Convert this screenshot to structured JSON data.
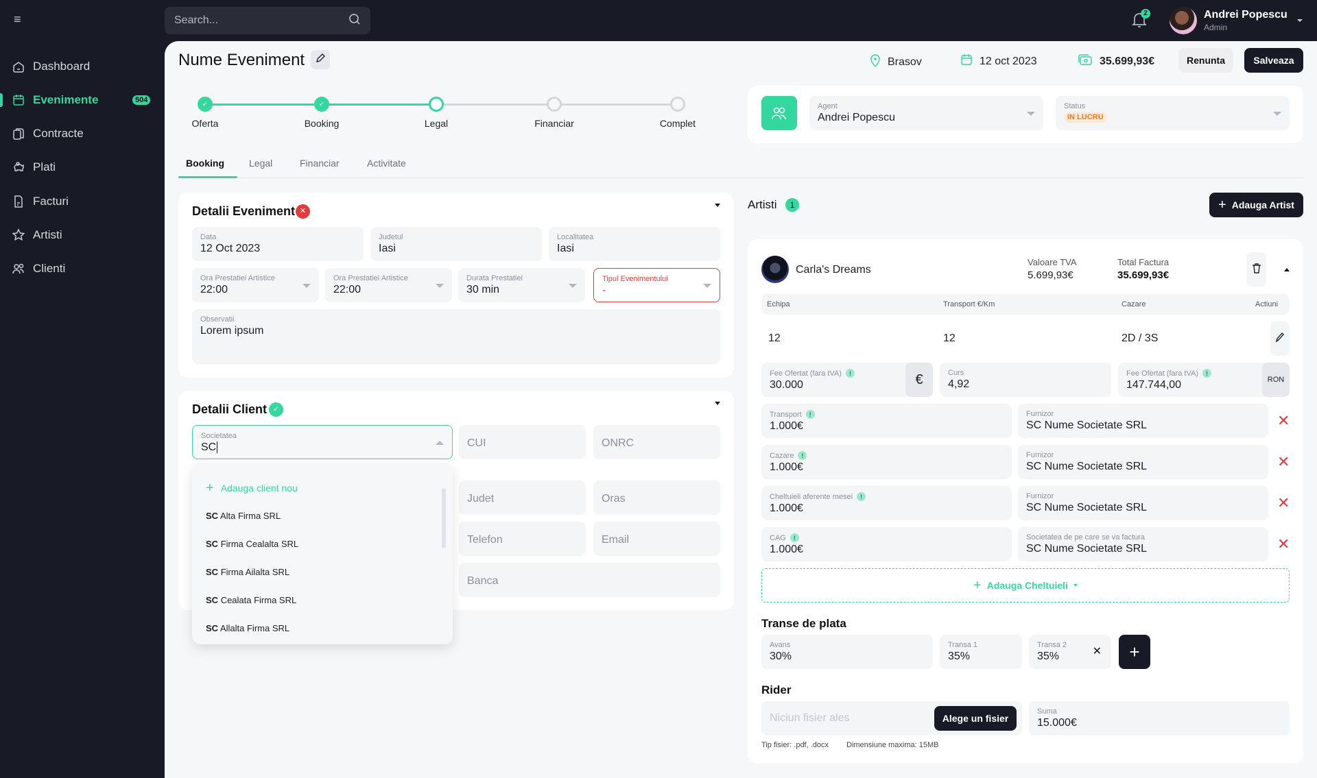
{
  "sidebar": {
    "menu_icon": "hamburger-icon",
    "items": [
      {
        "label": "Dashboard",
        "icon": "home-icon"
      },
      {
        "label": "Evenimente",
        "icon": "calendar-icon",
        "badge": "504",
        "active": true
      },
      {
        "label": "Contracte",
        "icon": "documents-icon"
      },
      {
        "label": "Plati",
        "icon": "piggy-bank-icon"
      },
      {
        "label": "Facturi",
        "icon": "invoice-icon"
      },
      {
        "label": "Artisti",
        "icon": "star-icon"
      },
      {
        "label": "Clienti",
        "icon": "users-icon"
      }
    ]
  },
  "topbar": {
    "search_placeholder": "Search...",
    "notifications_count": "2",
    "user": {
      "name": "Andrei Popescu",
      "role": "Admin"
    }
  },
  "header": {
    "title": "Nume Eveniment",
    "location": "Brasov",
    "date": "12 oct 2023",
    "total": "35.699,93€",
    "cancel_label": "Renunta",
    "save_label": "Salveaza"
  },
  "stepper": {
    "steps": [
      {
        "label": "Oferta",
        "state": "done"
      },
      {
        "label": "Booking",
        "state": "done"
      },
      {
        "label": "Legal",
        "state": "current"
      },
      {
        "label": "Financiar",
        "state": "todo"
      },
      {
        "label": "Complet",
        "state": "todo"
      }
    ]
  },
  "tabs": [
    {
      "label": "Booking",
      "active": true
    },
    {
      "label": "Legal"
    },
    {
      "label": "Financiar"
    },
    {
      "label": "Activitate"
    }
  ],
  "event_details": {
    "title": "Detalii Eveniment",
    "status": "error",
    "fields": {
      "data": {
        "label": "Data",
        "value": "12 Oct 2023"
      },
      "judet": {
        "label": "Judetul",
        "value": "Iasi"
      },
      "localitate": {
        "label": "Localitatea",
        "value": "Iasi"
      },
      "ora1": {
        "label": "Ora Prestatiei Artistice",
        "value": "22:00"
      },
      "ora2": {
        "label": "Ora Prestatiei Artistice",
        "value": "22:00"
      },
      "durata": {
        "label": "Durata Prestatiei",
        "value": "30 min"
      },
      "tip": {
        "label": "Tipul Evenimentului",
        "value": "-"
      },
      "observatii": {
        "label": "Observatii",
        "value": "Lorem ipsum"
      }
    }
  },
  "client_details": {
    "title": "Detalii Client",
    "status": "ok",
    "societatea": {
      "label": "Societatea",
      "value": "SC"
    },
    "placeholders": {
      "cui": "CUI",
      "onrc": "ONRC",
      "judet": "Judet",
      "oras": "Oras",
      "telefon": "Telefon",
      "email": "Email",
      "banca": "Banca"
    },
    "dropdown": {
      "add_label": "Adauga client nou",
      "options": [
        {
          "prefix": "SC",
          "name": "Alta Firma SRL"
        },
        {
          "prefix": "SC",
          "name": "Firma Cealalta SRL"
        },
        {
          "prefix": "SC",
          "name": "Firma Ailalta SRL"
        },
        {
          "prefix": "SC",
          "name": "Cealata Firma SRL"
        },
        {
          "prefix": "SC",
          "name": "Allalta Firma SRL"
        }
      ]
    }
  },
  "agent_card": {
    "agent": {
      "label": "Agent",
      "value": "Andrei Popescu"
    },
    "status": {
      "label": "Status",
      "value": "IN LUCRU",
      "color": "#f07c1a"
    }
  },
  "artists": {
    "title": "Artisti",
    "count": "1",
    "add_label": "Adauga Artist",
    "items": [
      {
        "name": "Carla's Dreams",
        "vat_label": "Valoare TVA",
        "vat": "5.699,93€",
        "total_label": "Total Factura",
        "total": "35.699,93€",
        "table": {
          "headers": [
            "Echipa",
            "Transport €/Km",
            "Cazare",
            "Actiuni"
          ],
          "row": [
            "12",
            "12",
            "2D / 3S"
          ]
        },
        "fee_eur": {
          "label": "Fee Ofertat (fara tVA)",
          "value": "30.000",
          "currency": "€"
        },
        "curs": {
          "label": "Curs",
          "value": "4,92"
        },
        "fee_ron": {
          "label": "Fee Ofertat (fara tVA)",
          "value": "147.744,00",
          "currency": "RON"
        },
        "expenses": [
          {
            "label": "Transport",
            "value": "1.000€",
            "supplier_label": "Furnizor",
            "supplier": "SC Nume Societate SRL"
          },
          {
            "label": "Cazare",
            "value": "1.000€",
            "supplier_label": "Furnizor",
            "supplier": "SC Nume Societate SRL"
          },
          {
            "label": "Cheltuieli aferente mesei",
            "value": "1.000€",
            "supplier_label": "Furnizor",
            "supplier": "SC Nume Societate SRL"
          },
          {
            "label": "CAG",
            "value": "1.000€",
            "supplier_label": "Societatea de pe care se va factura",
            "supplier": "SC Nume Societate SRL"
          }
        ],
        "add_expense_label": "Adauga Cheltuieli",
        "payments": {
          "title": "Transe de plata",
          "items": [
            {
              "label": "Avans",
              "value": "30%"
            },
            {
              "label": "Transa 1",
              "value": "35%"
            },
            {
              "label": "Transa 2",
              "value": "35%"
            }
          ]
        },
        "rider": {
          "title": "Rider",
          "file_placeholder": "Niciun fisier ales",
          "choose_label": "Alege un fisier",
          "sum_label": "Suma",
          "sum": "15.000€",
          "file_types": "Tip fisier: .pdf, .docx",
          "max_size": "Dimensiune maxima: 15MB"
        }
      }
    ]
  },
  "colors": {
    "accent": "#34d89f",
    "dark": "#181b25",
    "danger": "#e33b3b",
    "warning": "#f07c1a"
  }
}
